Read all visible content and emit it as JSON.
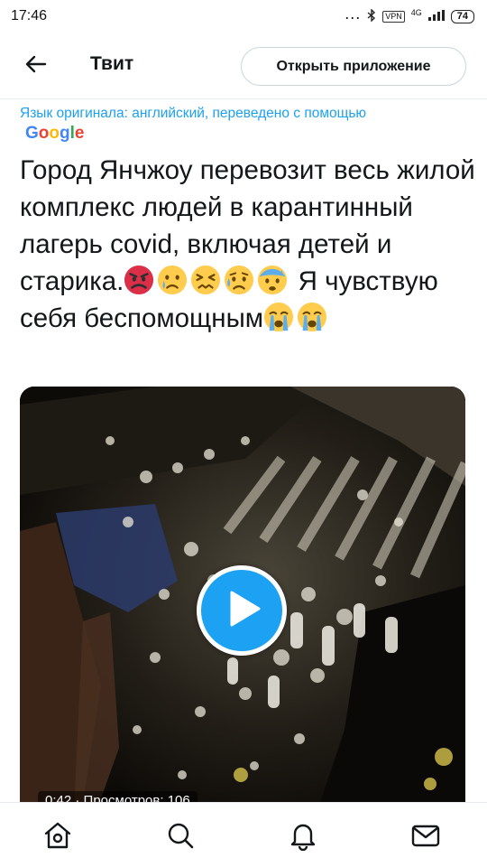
{
  "status_bar": {
    "time": "17:46",
    "dots": "...",
    "vpn": "VPN",
    "network": "4G",
    "battery": "74"
  },
  "header": {
    "title": "Твит",
    "back_icon": "arrow-left-icon",
    "open_app_label": "Открыть приложение"
  },
  "translation": {
    "text": "Язык оригинала: английский, переведено с помощью",
    "provider": "Google",
    "provider_colors": [
      "#4285f4",
      "#ea4335",
      "#fbbc05",
      "#4285f4",
      "#34a853",
      "#ea4335"
    ]
  },
  "tweet": {
    "text_part1": "Город Янчжоу перевозит весь жилой комплекс людей в карантинный лагерь covid, включая детей и старика.",
    "text_part2": " Я чувствую себя беспомощным",
    "emojis_after_part1": [
      "angry-face",
      "crying-face",
      "persevering-face",
      "sad-relieved-face",
      "anxious-face-with-sweat"
    ],
    "emojis_after_part2": [
      "loudly-crying-face",
      "loudly-crying-face"
    ]
  },
  "media": {
    "type": "video",
    "duration": "0:42",
    "views": "Просмотров: 106",
    "accent": "#1da1f2"
  },
  "bottom_nav": [
    {
      "name": "home",
      "icon": "home-icon"
    },
    {
      "name": "search",
      "icon": "search-icon"
    },
    {
      "name": "notifications",
      "icon": "bell-icon"
    },
    {
      "name": "messages",
      "icon": "mail-icon"
    }
  ],
  "colors": {
    "accent": "#1da1f2",
    "text": "#14171a",
    "border": "#e6ecf0"
  }
}
